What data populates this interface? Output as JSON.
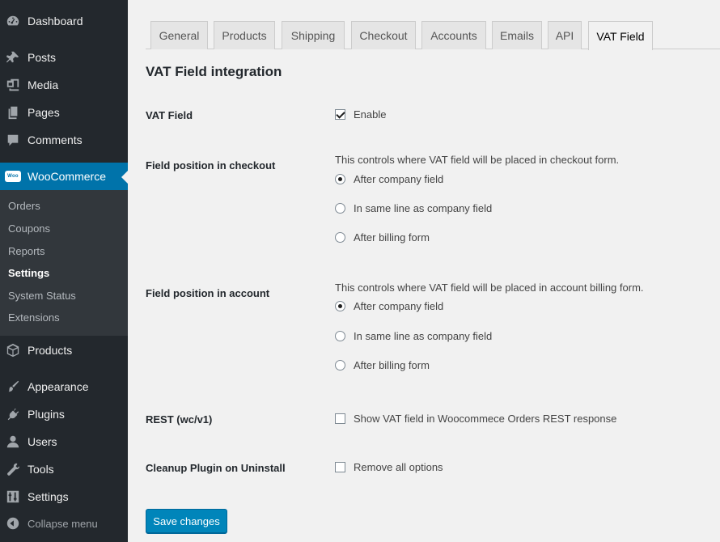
{
  "sidebar": {
    "items": [
      {
        "name": "dashboard",
        "label": "Dashboard",
        "icon": "dashboard-icon"
      },
      {
        "name": "posts",
        "label": "Posts",
        "icon": "pin-icon"
      },
      {
        "name": "media",
        "label": "Media",
        "icon": "media-icon"
      },
      {
        "name": "pages",
        "label": "Pages",
        "icon": "pages-icon"
      },
      {
        "name": "comments",
        "label": "Comments",
        "icon": "comment-icon"
      },
      {
        "name": "woocommerce",
        "label": "WooCommerce",
        "icon": "woo-icon",
        "badge": "Woo"
      },
      {
        "name": "products",
        "label": "Products",
        "icon": "cube-icon"
      },
      {
        "name": "appearance",
        "label": "Appearance",
        "icon": "brush-icon"
      },
      {
        "name": "plugins",
        "label": "Plugins",
        "icon": "plug-icon"
      },
      {
        "name": "users",
        "label": "Users",
        "icon": "user-icon"
      },
      {
        "name": "tools",
        "label": "Tools",
        "icon": "wrench-icon"
      },
      {
        "name": "settings",
        "label": "Settings",
        "icon": "sliders-icon"
      },
      {
        "name": "collapse",
        "label": "Collapse menu",
        "icon": "collapse-icon"
      }
    ],
    "submenu": [
      "Orders",
      "Coupons",
      "Reports",
      "Settings",
      "System Status",
      "Extensions"
    ],
    "current_submenu": "Settings"
  },
  "tabs": [
    "General",
    "Products",
    "Shipping",
    "Checkout",
    "Accounts",
    "Emails",
    "API",
    "VAT Field"
  ],
  "active_tab": "VAT Field",
  "page": {
    "heading": "VAT Field integration",
    "vat_field": {
      "label": "VAT Field",
      "option": "Enable",
      "checked": true
    },
    "checkout_position": {
      "label": "Field position in checkout",
      "description": "This controls where VAT field will be placed in checkout form.",
      "options": [
        "After company field",
        "In same line as company field",
        "After billing form"
      ],
      "selected": "After company field"
    },
    "account_position": {
      "label": "Field position in account",
      "description": "This controls where VAT field will be placed in account billing form.",
      "options": [
        "After company field",
        "In same line as company field",
        "After billing form"
      ],
      "selected": "After company field"
    },
    "rest": {
      "label": "REST (wc/v1)",
      "option": "Show VAT field in Woocommece Orders REST response",
      "checked": false
    },
    "cleanup": {
      "label": "Cleanup Plugin on Uninstall",
      "option": "Remove all options",
      "checked": false
    },
    "save_label": "Save changes"
  },
  "colors": {
    "sidebar": "#23282d",
    "submenu": "#32373c",
    "accent": "#0073aa",
    "button": "#0085ba"
  }
}
